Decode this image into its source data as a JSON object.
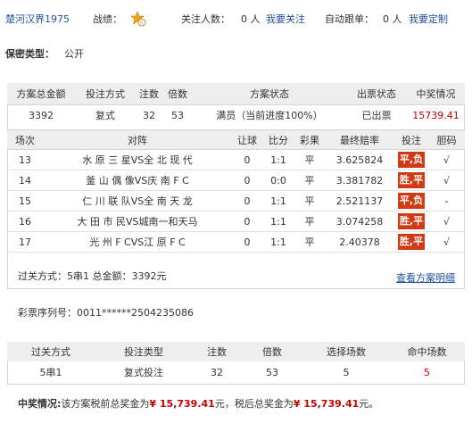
{
  "header": {
    "username": "楚河汉界1975",
    "record_label": "战绩：",
    "record_icon": "star-medal-icon",
    "followers_label": "关注人数：",
    "followers_value": "0 人",
    "follow_link": "我要关注",
    "autofollow_label": "自动跟单：",
    "autofollow_value": "0 人",
    "custom_link": "我要定制"
  },
  "secrecy": {
    "label": "保密类型：",
    "value": "公开"
  },
  "summary": {
    "headers": [
      "方案总金额",
      "投注方式",
      "注数",
      "倍数",
      "方案状态",
      "出票状态",
      "中奖情况"
    ],
    "total": "3392",
    "method": "复式",
    "count": "32",
    "multiple": "53",
    "status": "满员（当前进度100%）",
    "ticket_status": "已出票",
    "prize": "15739.41"
  },
  "matches": {
    "headers": [
      "场次",
      "对阵",
      "让球",
      "比分",
      "彩果",
      "最终赔率",
      "投注",
      "胆码"
    ],
    "rows": [
      {
        "no": "13",
        "match": "水 原 三 星VS全 北 现 代",
        "handicap": "0",
        "score": "1:1",
        "result": "平",
        "odds": "3.625824",
        "bet": "平,负",
        "banker": "√"
      },
      {
        "no": "14",
        "match": "釜 山 偶 像VS庆 南 F C",
        "handicap": "0",
        "score": "0:0",
        "result": "平",
        "odds": "3.381782",
        "bet": "胜,平",
        "banker": "√"
      },
      {
        "no": "15",
        "match": "仁 川 联 队VS全 南 天 龙",
        "handicap": "0",
        "score": "1:1",
        "result": "平",
        "odds": "2.521137",
        "bet": "平,负",
        "banker": "-"
      },
      {
        "no": "16",
        "match": "大 田 市 民VS城南一和天马",
        "handicap": "0",
        "score": "1:1",
        "result": "平",
        "odds": "3.074258",
        "bet": "胜,平",
        "banker": "√"
      },
      {
        "no": "17",
        "match": "光 州 F CVS江 原 F C",
        "handicap": "0",
        "score": "1:1",
        "result": "平",
        "odds": "2.40378",
        "bet": "胜,平",
        "banker": "√"
      }
    ]
  },
  "pass_info": "过关方式：5串1 总金额：3392元",
  "view_detail_link": "查看方案明细",
  "serial": "彩票序列号：0011******2504235086",
  "pass_table": {
    "headers": [
      "过关方式",
      "投注类型",
      "注数",
      "倍数",
      "选择场数",
      "命中场数"
    ],
    "row": [
      "5串1",
      "复式投注",
      "32",
      "53",
      "5",
      "5"
    ]
  },
  "prize_info": {
    "label": "中奖情况:",
    "text1": "该方案税前总奖金为",
    "pre_tax": "¥ 15,739.41",
    "text2": "元，税后总奖金为",
    "after_tax": "¥ 15,739.41",
    "text3": "元。"
  },
  "colors": {
    "link": "#1f4f9a",
    "accent_red": "#c80000",
    "pick_bg": "#d23a13"
  }
}
